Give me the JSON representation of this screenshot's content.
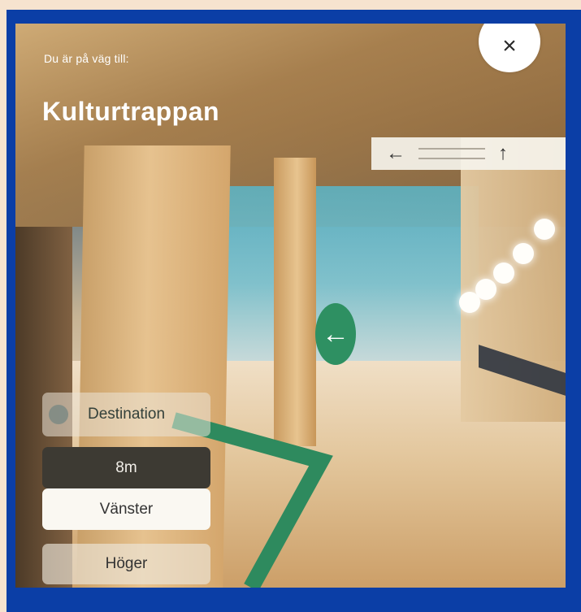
{
  "header": {
    "label": "Du är på väg till:",
    "destination_title": "Kulturtrappan"
  },
  "close_button": {
    "icon": "close-icon",
    "glyph": "×"
  },
  "sign": {
    "icon_left": "arrow-left-icon",
    "glyph_left": "←",
    "icon_up": "arrow-up-icon",
    "glyph_up": "↑"
  },
  "ar_marker": {
    "icon": "arrow-left-icon",
    "glyph": "←",
    "color": "#2e9062"
  },
  "controls": {
    "destination": "Destination",
    "distance": "8m",
    "left": "Vänster",
    "right": "Höger"
  },
  "colors": {
    "frame": "#0b3ea6",
    "route": "#2e8a5e",
    "background": "#f6e3cf"
  }
}
